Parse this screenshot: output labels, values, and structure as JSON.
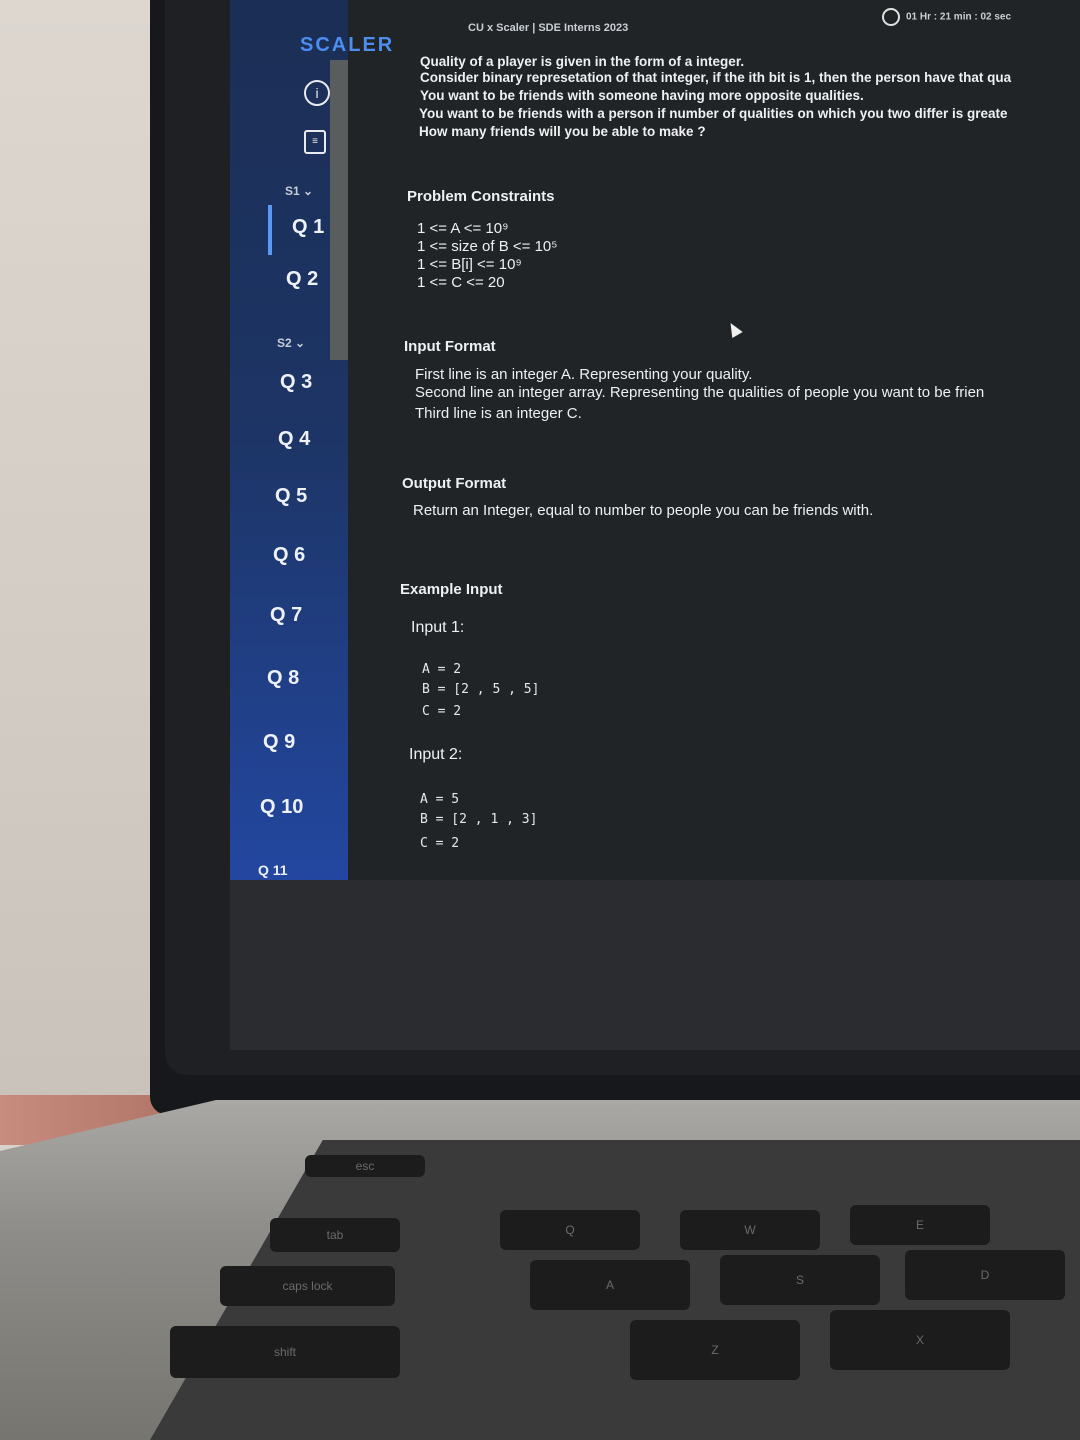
{
  "app": {
    "brand": "SCALER",
    "title": "CU x Scaler | SDE Interns 2023",
    "timer": "01 Hr : 21 min : 02 sec"
  },
  "sidebar": {
    "icons": [
      "info-icon",
      "notes-icon"
    ],
    "sections": [
      {
        "label": "S1",
        "items": [
          "Q 1",
          "Q 2"
        ]
      },
      {
        "label": "S2",
        "items": [
          "Q 3",
          "Q 4",
          "Q 5",
          "Q 6",
          "Q 7",
          "Q 8",
          "Q 9",
          "Q 10",
          "Q 11"
        ]
      }
    ]
  },
  "problem": {
    "statement": [
      "Quality of a player is given in the form of a integer.",
      "Consider binary represetation of that integer, if the ith bit is 1, then the person have that qua",
      "You want to be friends with someone having more opposite qualities.",
      "You want to be friends with a person if number of qualities on which you two differ is greate",
      "How many friends will you be able to make ?"
    ],
    "constraints_title": "Problem Constraints",
    "constraints": [
      "1 <= A <= 10⁹",
      "1 <= size of B <= 10⁵",
      "1 <= B[i] <= 10⁹",
      "1 <= C <= 20"
    ],
    "input_title": "Input Format",
    "input_lines": [
      "First line is an integer A. Representing your quality.",
      "Second line an integer array. Representing the qualities of people you want to be frien",
      "Third line is an integer C."
    ],
    "output_title": "Output Format",
    "output_line": "Return an Integer, equal to number to people you can be friends with.",
    "example_title": "Example Input",
    "input1_label": "Input 1:",
    "input1": [
      "A = 2",
      "B = [2 , 5 , 5]",
      "C = 2"
    ],
    "input2_label": "Input 2:",
    "input2": [
      "A = 5",
      "B = [2 , 1 , 3]",
      "C = 2"
    ]
  },
  "keyboard": {
    "keys": [
      "esc",
      "tab",
      "caps lock",
      "shift",
      "Q",
      "W",
      "E",
      "A",
      "S",
      "D",
      "Z",
      "X"
    ]
  }
}
